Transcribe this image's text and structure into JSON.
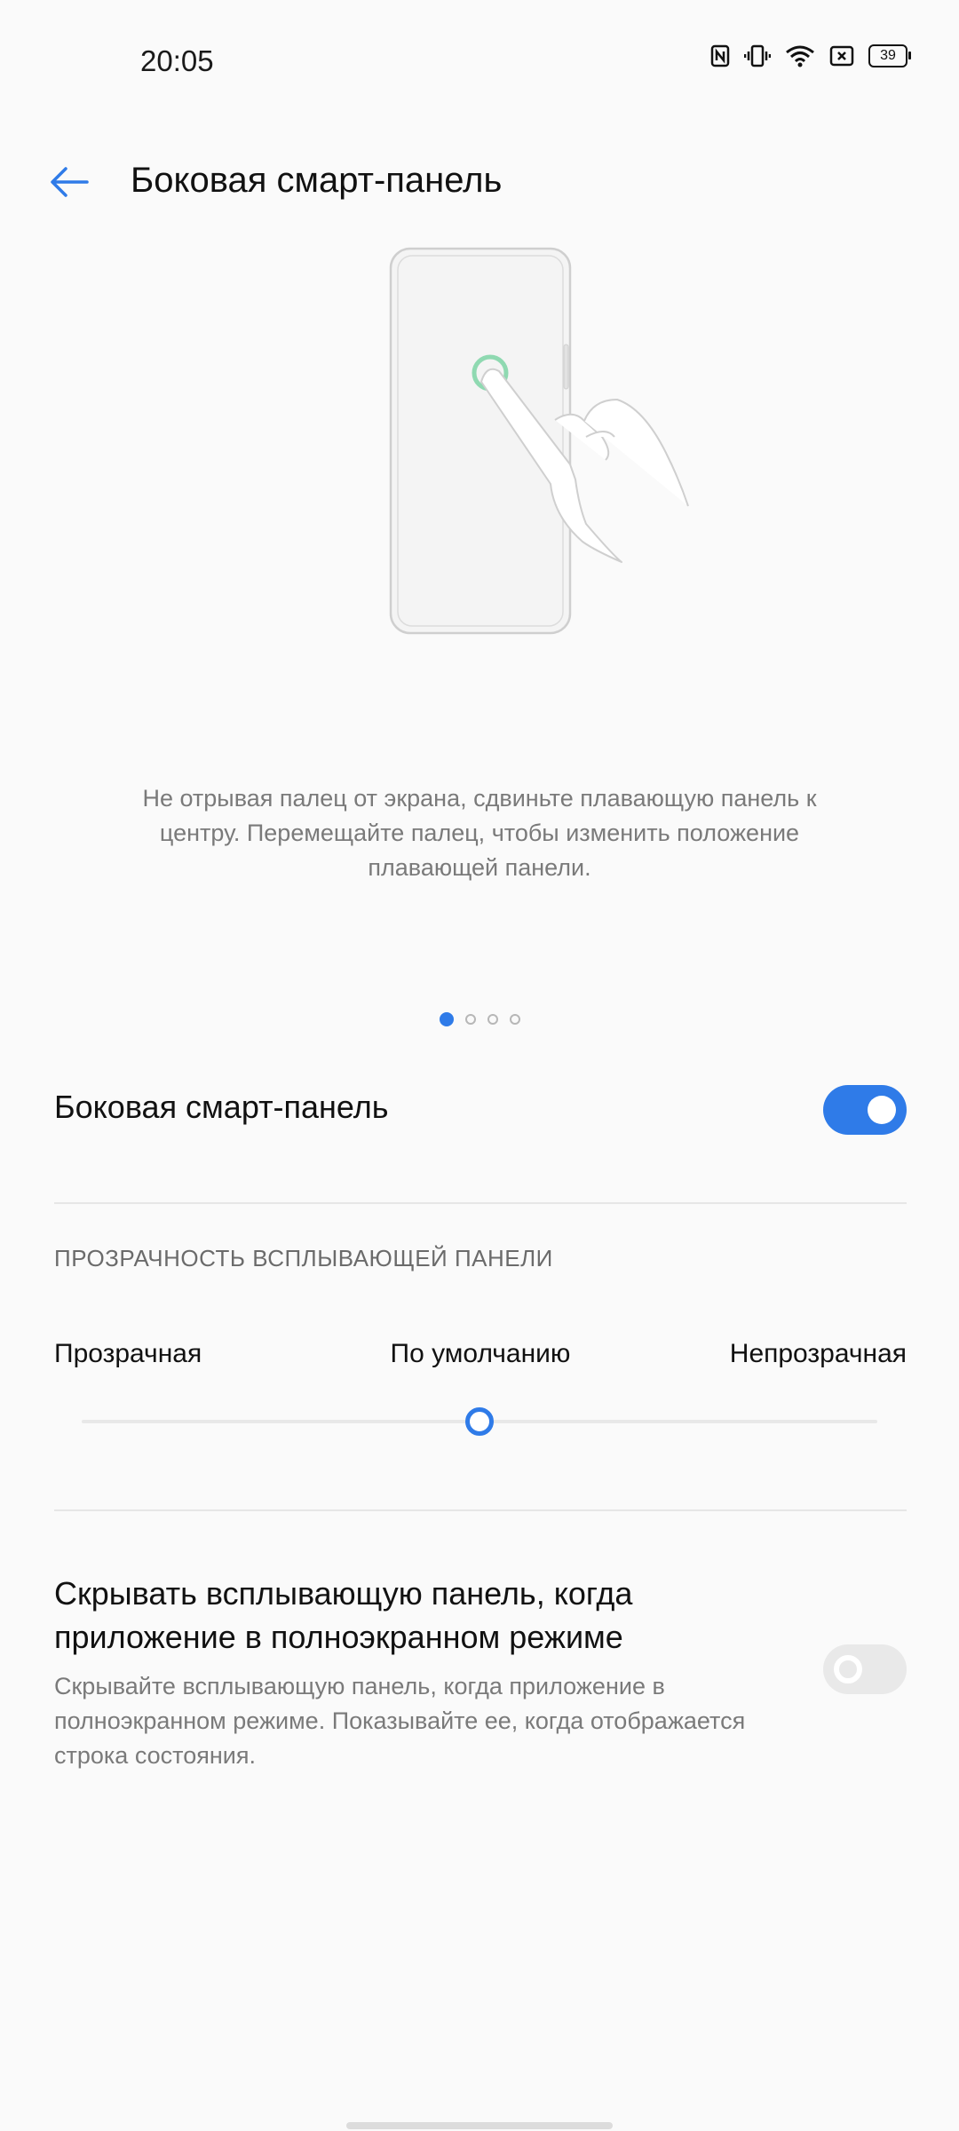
{
  "status_bar": {
    "time": "20:05",
    "icons": [
      "nfc-icon",
      "vibrate-icon",
      "wifi-icon",
      "sim-icon",
      "battery-icon"
    ],
    "battery_level": "39"
  },
  "header": {
    "back_icon": "arrow-left-icon",
    "title": "Боковая смарт-панель"
  },
  "illustration": {
    "description": "Не отрывая палец от экрана, сдвиньте плавающую панель к центру. Перемещайте палец, чтобы изменить положение плавающей панели.",
    "page_count": 4,
    "active_page": 1
  },
  "smart_panel": {
    "label": "Боковая смарт-панель",
    "enabled": true
  },
  "transparency": {
    "section_header": "ПРОЗРАЧНОСТЬ ВСПЛЫВАЮЩЕЙ ПАНЕЛИ",
    "label_left": "Прозрачная",
    "label_center": "По умолчанию",
    "label_right": "Непрозрачная",
    "value_fraction": 0.5
  },
  "hide_fullscreen": {
    "title": "Скрывать всплывающую панель, когда приложение в полноэкранном режиме",
    "description": "Скрывайте всплывающую панель, когда приложение в полноэкранном режиме. Показывайте ее, когда отображается строка состояния.",
    "enabled": false
  },
  "colors": {
    "accent": "#2f7be8",
    "background": "#fafafa",
    "secondary_text": "#7a7a7a",
    "touch_ring": "#8fd9b1"
  }
}
